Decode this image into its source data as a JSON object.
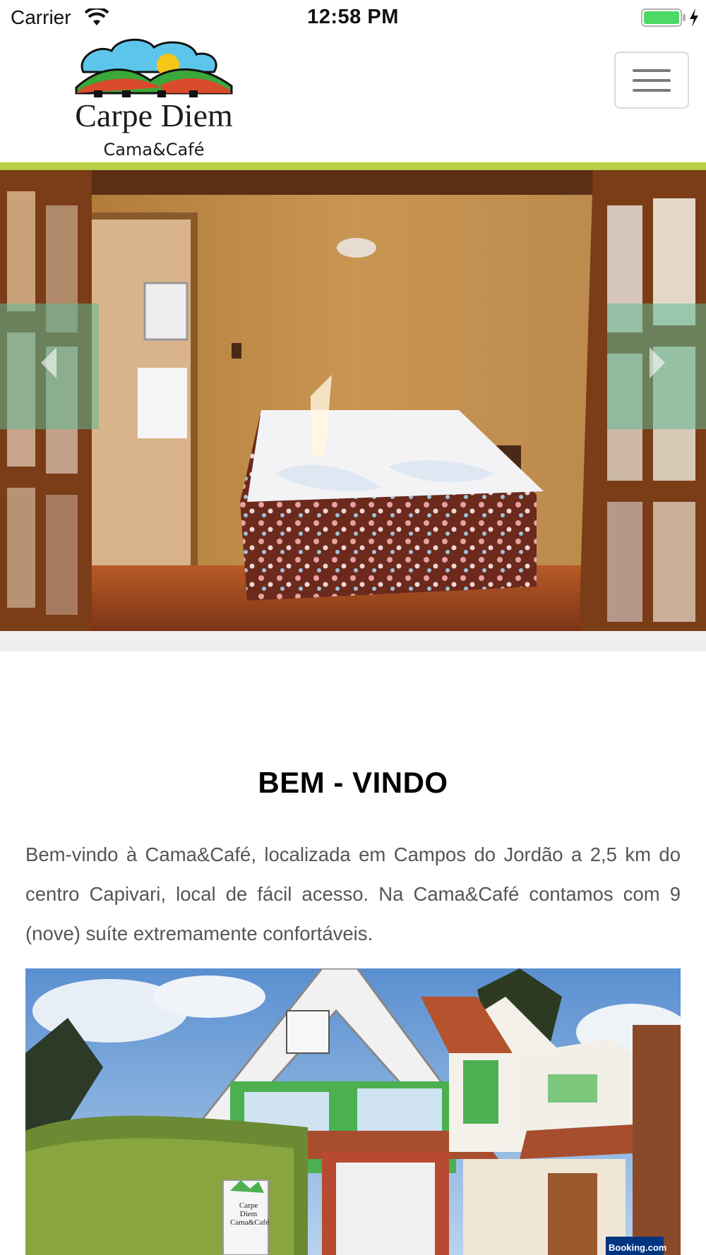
{
  "status_bar": {
    "carrier": "Carrier",
    "time": "12:58 PM",
    "battery_level": 1.0,
    "wifi_icon": "wifi-icon",
    "charging_icon": "bolt-icon"
  },
  "header": {
    "logo_title": "Carpe Diem",
    "logo_subtitle": "Cama&Café",
    "menu_icon": "hamburger-icon",
    "accent_color": "#b6cf44"
  },
  "carousel": {
    "prev_icon": "chevron-left-icon",
    "next_icon": "chevron-right-icon",
    "control_color": "#5fb996"
  },
  "welcome": {
    "title": "BEM - VINDO",
    "text": "Bem-vindo à Cama&Café, localizada em Campos do Jordão a 2,5 km do centro Capivari, local de fácil acesso. Na Cama&Café contamos com 9 (nove) suíte extremamente confortáveis."
  },
  "house_photo": {
    "sign_title": "Carpe Diem",
    "sign_subtitle": "Cama&Café",
    "badge": "Booking.com"
  }
}
